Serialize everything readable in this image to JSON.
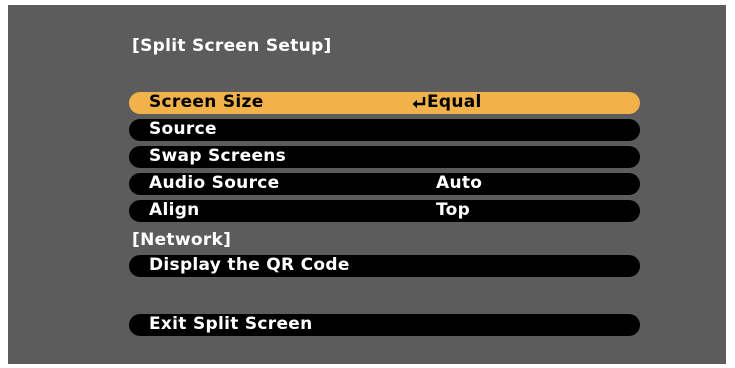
{
  "menu": {
    "title": "[Split Screen Setup]",
    "items": [
      {
        "label": "Screen Size",
        "value": "Equal",
        "icon": "enter-icon",
        "selected": true
      },
      {
        "label": "Source",
        "value": ""
      },
      {
        "label": "Swap Screens",
        "value": ""
      },
      {
        "label": "Audio Source",
        "value": "Auto"
      },
      {
        "label": "Align",
        "value": "Top"
      }
    ],
    "network_heading": "[Network]",
    "network_items": [
      {
        "label": "Display the QR Code"
      }
    ],
    "exit_label": "Exit Split Screen"
  },
  "colors": {
    "background": "#5c5c5c",
    "row_background": "#000000",
    "selected_background": "#f1b24a",
    "text": "#ffffff",
    "selected_text": "#000000"
  }
}
